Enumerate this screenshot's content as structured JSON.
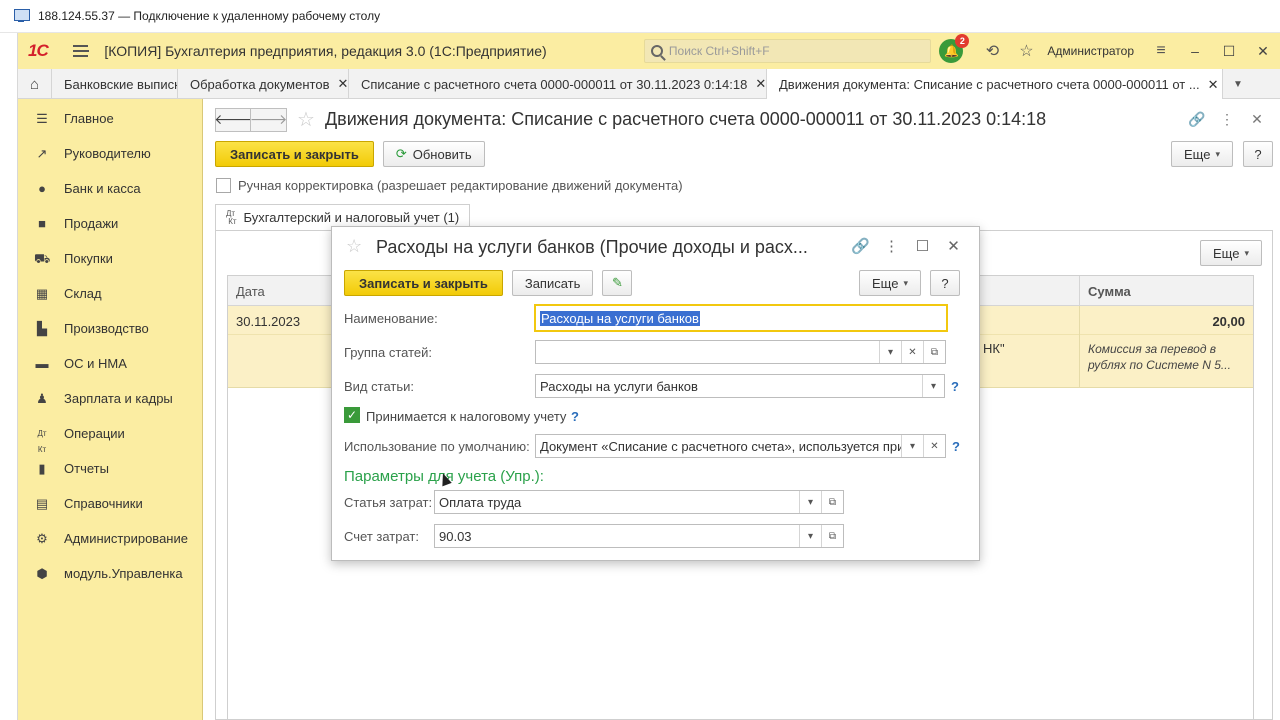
{
  "rdp": {
    "title": "188.124.55.37 — Подключение к удаленному рабочему столу"
  },
  "app": {
    "logo": "1С",
    "title": "[КОПИЯ] Бухгалтерия предприятия, редакция 3.0  (1С:Предприятие)",
    "search_placeholder": "Поиск Ctrl+Shift+F",
    "notifications_count": "2",
    "user": "Администратор"
  },
  "tabs": [
    {
      "label": "Банковские выписки"
    },
    {
      "label": "Обработка документов"
    },
    {
      "label": "Списание с расчетного счета 0000-000011 от 30.11.2023 0:14:18"
    },
    {
      "label": "Движения документа: Списание с расчетного счета 0000-000011 от ..."
    }
  ],
  "sidebar": {
    "items": [
      {
        "label": "Главное",
        "icon": "menu-lines-icon"
      },
      {
        "label": "Руководителю",
        "icon": "trend-icon"
      },
      {
        "label": "Банк и касса",
        "icon": "coin-icon"
      },
      {
        "label": "Продажи",
        "icon": "bag-icon"
      },
      {
        "label": "Покупки",
        "icon": "cart-icon"
      },
      {
        "label": "Склад",
        "icon": "warehouse-icon"
      },
      {
        "label": "Производство",
        "icon": "factory-icon"
      },
      {
        "label": "ОС и НМА",
        "icon": "truck-icon"
      },
      {
        "label": "Зарплата и кадры",
        "icon": "person-icon"
      },
      {
        "label": "Операции",
        "icon": "dt-kt-icon"
      },
      {
        "label": "Отчеты",
        "icon": "bar-chart-icon"
      },
      {
        "label": "Справочники",
        "icon": "book-icon"
      },
      {
        "label": "Администрирование",
        "icon": "gear-icon"
      },
      {
        "label": "модуль.Управленка",
        "icon": "cube-icon"
      }
    ]
  },
  "form": {
    "title": "Движения документа: Списание с расчетного счета 0000-000011 от 30.11.2023 0:14:18",
    "save_close": "Записать и закрыть",
    "refresh": "Обновить",
    "more": "Еще",
    "help": "?",
    "manual_edit": "Ручная корректировка (разрешает редактирование движений документа)",
    "inner_tab": "Бухгалтерский и налоговый учет (1)",
    "dt_kt": "Дт Кт",
    "table": {
      "headers": {
        "date": "Дата",
        "sum": "Сумма"
      },
      "rows": [
        {
          "date": "30.11.2023",
          "sum": "20,00",
          "bank_fragment": "НК\"",
          "comment": "Комиссия за перевод в рублях по Системе N 5..."
        }
      ]
    }
  },
  "dialog": {
    "title": "Расходы на услуги банков (Прочие доходы и расх...",
    "save_close": "Записать и закрыть",
    "save": "Записать",
    "more": "Еще",
    "help": "?",
    "fields": {
      "name_label": "Наименование:",
      "name_value": "Расходы на услуги банков",
      "group_label": "Группа статей:",
      "group_value": "",
      "kind_label": "Вид статьи:",
      "kind_value": "Расходы на услуги банков",
      "tax_label": "Принимается к налоговому учету",
      "usage_label": "Использование по умолчанию:",
      "usage_value": "Документ «Списание с расчетного счета», используется при",
      "section": "Параметры для учета (Упр.):",
      "cost_item_label": "Статья затрат:",
      "cost_item_value": "Оплата труда",
      "cost_account_label": "Счет затрат:",
      "cost_account_value": "90.03"
    }
  },
  "colors": {
    "brand_yellow": "#fbeda2",
    "button_yellow": "#f4d21a",
    "section_green": "#2aa14a",
    "link_blue": "#2a6ebb",
    "row_highlight": "#fbf0c6"
  }
}
